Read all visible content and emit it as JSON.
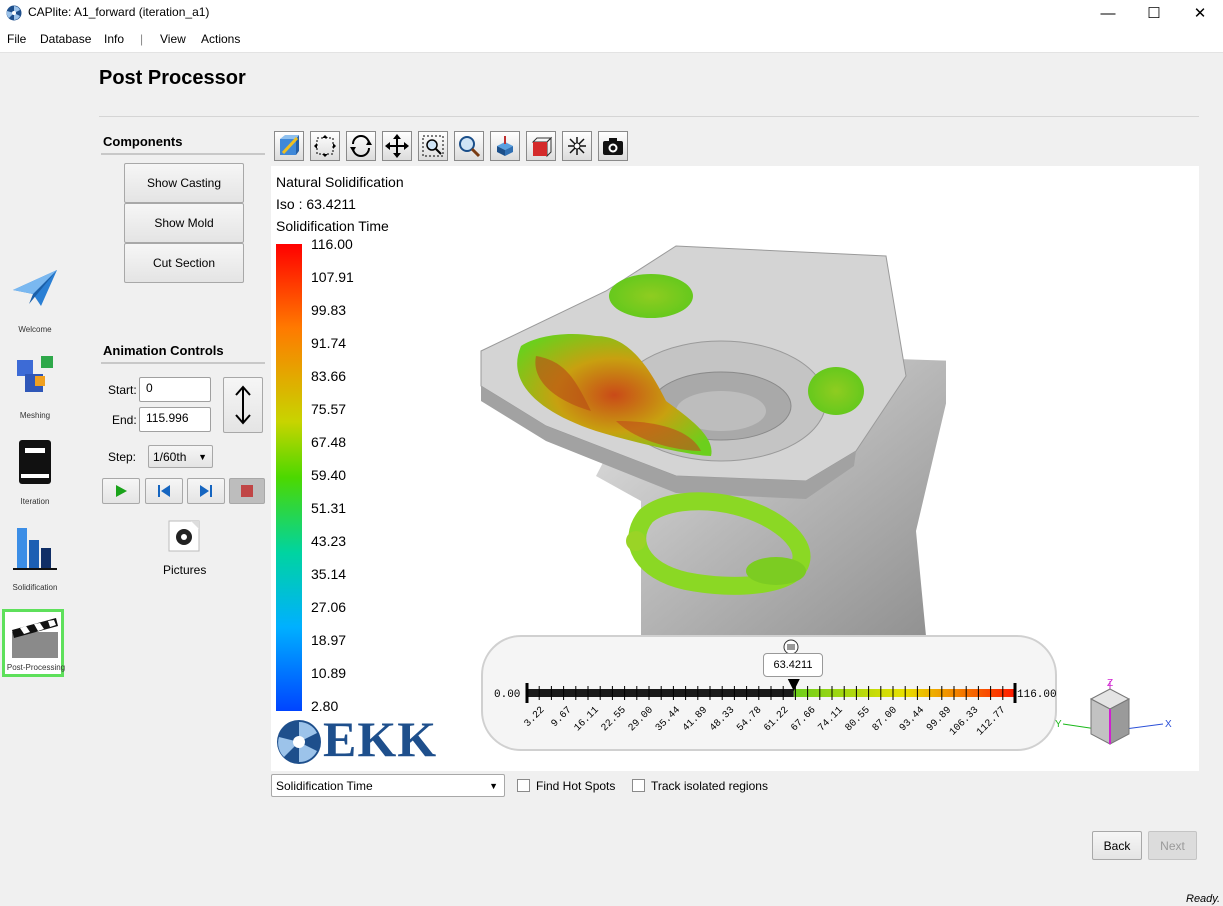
{
  "window": {
    "title": "CAPlite: A1_forward (iteration_a1)",
    "minimize": "—",
    "maximize": "☐",
    "close": "✕"
  },
  "menu": [
    "File",
    "Database",
    "Info",
    "|",
    "View",
    "Actions"
  ],
  "nav": [
    {
      "label": "Welcome",
      "icon": "paper-plane-icon"
    },
    {
      "label": "Meshing",
      "icon": "cubes-icon"
    },
    {
      "label": "Iteration",
      "icon": "book-icon"
    },
    {
      "label": "Solidification",
      "icon": "bar-chart-icon"
    },
    {
      "label": "Post-Processing",
      "icon": "clapperboard-icon"
    }
  ],
  "page_title": "Post Processor",
  "components": {
    "heading": "Components",
    "buttons": [
      "Show Casting",
      "Show Mold",
      "Cut Section"
    ]
  },
  "animation": {
    "heading": "Animation Controls",
    "start_label": "Start:",
    "start_value": "0",
    "end_label": "End:",
    "end_value": "115.996",
    "step_label": "Step:",
    "step_value": "1/60th",
    "pictures_label": "Pictures"
  },
  "viewport": {
    "mode": "Natural Solidification",
    "iso_line": "Iso :  63.4211",
    "field": "Solidification Time",
    "colorbar_ticks": [
      "116.00",
      "107.91",
      "99.83",
      "91.74",
      "83.66",
      "75.57",
      "67.48",
      "59.40",
      "51.31",
      "43.23",
      "35.14",
      "27.06",
      "18.97",
      "10.89",
      "2.80"
    ],
    "logo_text": "EKK"
  },
  "slider": {
    "value_label": "63.4211",
    "value_fraction": 0.5467,
    "min_label": "0.00",
    "max_label": "116.00",
    "ticks": [
      "3.22",
      "9.67",
      "16.11",
      "22.55",
      "29.00",
      "35.44",
      "41.89",
      "48.33",
      "54.78",
      "61.22",
      "67.66",
      "74.11",
      "80.55",
      "87.00",
      "93.44",
      "99.89",
      "106.33",
      "112.77"
    ]
  },
  "axes": {
    "x": "X",
    "y": "Y",
    "z": "Z"
  },
  "bottom": {
    "dropdown_value": "Solidification Time",
    "find_hot_spots": "Find Hot Spots",
    "track_isolated": "Track isolated regions"
  },
  "nav_buttons": {
    "back": "Back",
    "next": "Next"
  },
  "status": "Ready.",
  "colors": {
    "nav_highlight": "#5ee05b",
    "play_green": "#1aa31a",
    "stop_red": "#c04545",
    "nav_blue": "#1565c0"
  }
}
